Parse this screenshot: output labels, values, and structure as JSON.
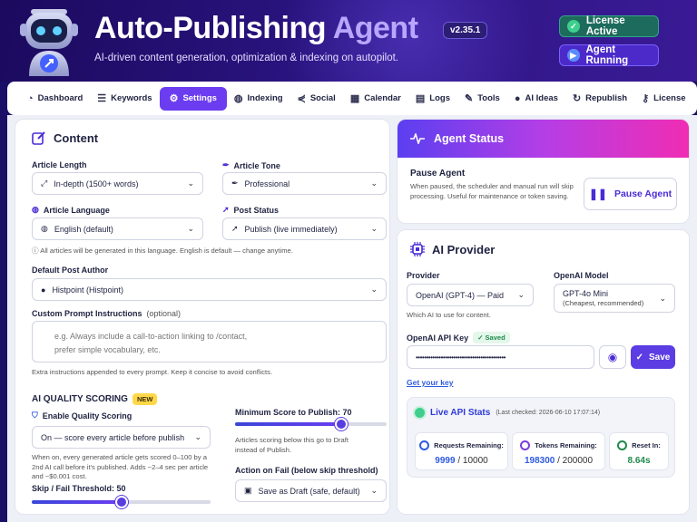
{
  "header": {
    "title_main": "Auto-Publishing",
    "title_accent": "Agent",
    "version": "v2.35.1",
    "subtitle": "AI-driven content generation, optimization & indexing on autopilot.",
    "license_pill": "License Active",
    "running_pill": "Agent Running"
  },
  "nav": {
    "items": [
      {
        "label": "Dashboard",
        "icon": "gauge-icon"
      },
      {
        "label": "Keywords",
        "icon": "list-icon"
      },
      {
        "label": "Settings",
        "icon": "gear-icon"
      },
      {
        "label": "Indexing",
        "icon": "globe-icon"
      },
      {
        "label": "Social",
        "icon": "share-icon"
      },
      {
        "label": "Calendar",
        "icon": "calendar-icon"
      },
      {
        "label": "Logs",
        "icon": "document-icon"
      },
      {
        "label": "Tools",
        "icon": "wrench-icon"
      },
      {
        "label": "AI Ideas",
        "icon": "lightbulb-icon"
      },
      {
        "label": "Republish",
        "icon": "refresh-icon"
      },
      {
        "label": "License",
        "icon": "key-icon"
      }
    ],
    "active": "Settings"
  },
  "content": {
    "title": "Content",
    "article_length_label": "Article Length",
    "article_length_value": "In-depth (1500+ words)",
    "article_tone_label": "Article Tone",
    "article_tone_value": "Professional",
    "article_language_label": "Article Language",
    "article_language_value": "English (default)",
    "post_status_label": "Post Status",
    "post_status_value": "Publish (live immediately)",
    "language_hint": "All articles will be generated in this language. English is default — change anytime.",
    "author_label": "Default Post Author",
    "author_value": "Histpoint (Histpoint)",
    "prompt_label": "Custom Prompt Instructions",
    "prompt_optional": "(optional)",
    "prompt_placeholder_line1": "e.g. Always include a call-to-action linking to /contact,",
    "prompt_placeholder_line2": "prefer simple vocabulary, etc.",
    "prompt_hint": "Extra instructions appended to every prompt. Keep it concise to avoid conflicts."
  },
  "quality": {
    "title": "AI QUALITY SCORING",
    "badge": "NEW",
    "enable_label": "Enable Quality Scoring",
    "enable_value": "On  — score every article before publish",
    "enable_hint": "When on, every generated article gets scored 0–100 by a 2nd AI call before it's published. Adds ~2–4 sec per article and ~$0.001 cost.",
    "skip_label": "Skip / Fail Threshold: 50",
    "skip_value": 50,
    "min_score_label": "Minimum Score to Publish: 70",
    "min_score_value": 70,
    "min_score_hint": "Articles scoring below this go to Draft instead of Publish.",
    "action_label": "Action on Fail (below skip threshold)",
    "action_value": "Save as Draft (safe, default)"
  },
  "agent_status": {
    "title": "Agent Status",
    "pause_title": "Pause Agent",
    "pause_desc": "When paused, the scheduler and manual run will skip processing. Useful for maintenance or token saving.",
    "pause_button": "Pause Agent"
  },
  "provider": {
    "title": "AI Provider",
    "provider_label": "Provider",
    "provider_value": "OpenAI (GPT-4) — Paid",
    "provider_hint": "Which AI to use for content.",
    "model_label": "OpenAI Model",
    "model_value": "GPT-4o Mini",
    "model_sub": "(Cheapest, recommended)",
    "key_label": "OpenAI API Key",
    "saved_badge": "✓ Saved",
    "key_value": "•••••••••••••••••••••••••••••••••••••••••••",
    "save_button": "Save",
    "get_key_link": "Get your key"
  },
  "stats": {
    "title": "Live API Stats",
    "last_checked": "(Last checked: 2026-06-10 17:07:14)",
    "requests_label": "Requests Remaining:",
    "requests_value": "9999",
    "requests_total": "/ 10000",
    "tokens_label": "Tokens Remaining:",
    "tokens_value": "198300",
    "tokens_total": "/ 200000",
    "reset_label": "Reset In:",
    "reset_value": "8.64s"
  }
}
